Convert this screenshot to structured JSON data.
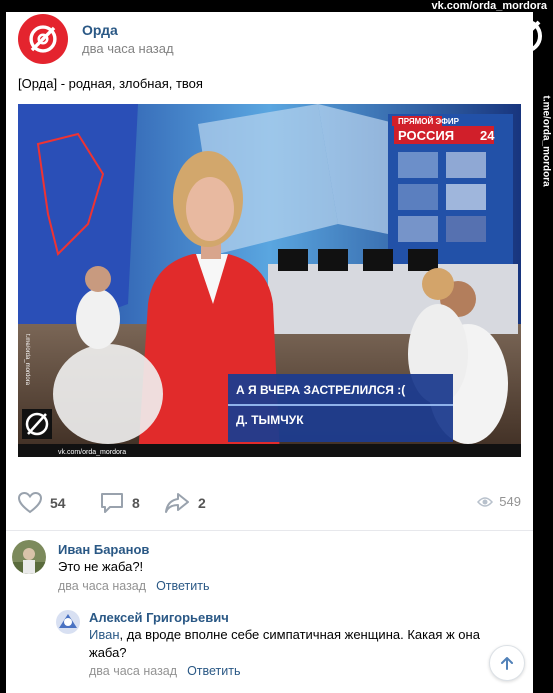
{
  "watermark": {
    "top_text": "vk.com/orda_mordora",
    "side_text": "t.me/orda_mordora"
  },
  "post": {
    "author": "Орда",
    "time": "два часа назад",
    "text": "[Орда] - родная, злобная, твоя",
    "image": {
      "live_label": "ПРЯМОЙ ЭФИР",
      "channel": "РОССИЯ",
      "channel_num": "24",
      "caption_line1": "А Я ВЧЕРА ЗАСТРЕЛИЛСЯ :(",
      "caption_line2": "Д. ТЫМЧУК",
      "wm_bottom": "vk.com/orda_mordora",
      "wm_side": "t.me/orda_mordora"
    },
    "likes": "54",
    "comments": "8",
    "shares": "2",
    "views": "549"
  },
  "comments": [
    {
      "name": "Иван Баранов",
      "text": "Это не жаба?!",
      "time": "два часа назад",
      "reply": "Ответить"
    },
    {
      "name": "Алексей Григорьевич",
      "mention": "Иван",
      "text": ", да вроде вполне себе симпатичная женщина. Какая ж она жаба?",
      "time": "два часа назад",
      "reply": "Ответить"
    }
  ],
  "colors": {
    "brand_red": "#e4242e",
    "link_blue": "#2a5885",
    "meta_gray": "#939393"
  }
}
